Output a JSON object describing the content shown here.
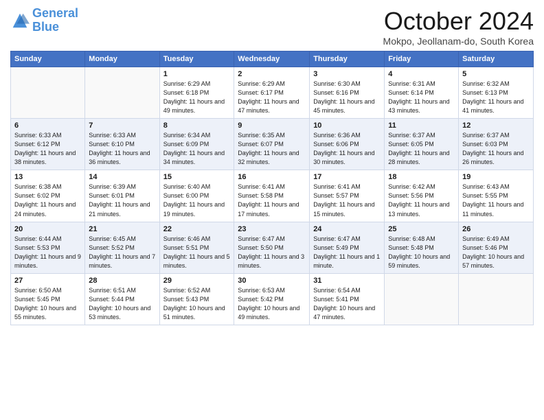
{
  "header": {
    "logo_general": "General",
    "logo_blue": "Blue",
    "title": "October 2024",
    "location": "Mokpo, Jeollanam-do, South Korea"
  },
  "weekdays": [
    "Sunday",
    "Monday",
    "Tuesday",
    "Wednesday",
    "Thursday",
    "Friday",
    "Saturday"
  ],
  "weeks": [
    [
      {
        "day": "",
        "detail": ""
      },
      {
        "day": "",
        "detail": ""
      },
      {
        "day": "1",
        "detail": "Sunrise: 6:29 AM\nSunset: 6:18 PM\nDaylight: 11 hours and 49 minutes."
      },
      {
        "day": "2",
        "detail": "Sunrise: 6:29 AM\nSunset: 6:17 PM\nDaylight: 11 hours and 47 minutes."
      },
      {
        "day": "3",
        "detail": "Sunrise: 6:30 AM\nSunset: 6:16 PM\nDaylight: 11 hours and 45 minutes."
      },
      {
        "day": "4",
        "detail": "Sunrise: 6:31 AM\nSunset: 6:14 PM\nDaylight: 11 hours and 43 minutes."
      },
      {
        "day": "5",
        "detail": "Sunrise: 6:32 AM\nSunset: 6:13 PM\nDaylight: 11 hours and 41 minutes."
      }
    ],
    [
      {
        "day": "6",
        "detail": "Sunrise: 6:33 AM\nSunset: 6:12 PM\nDaylight: 11 hours and 38 minutes."
      },
      {
        "day": "7",
        "detail": "Sunrise: 6:33 AM\nSunset: 6:10 PM\nDaylight: 11 hours and 36 minutes."
      },
      {
        "day": "8",
        "detail": "Sunrise: 6:34 AM\nSunset: 6:09 PM\nDaylight: 11 hours and 34 minutes."
      },
      {
        "day": "9",
        "detail": "Sunrise: 6:35 AM\nSunset: 6:07 PM\nDaylight: 11 hours and 32 minutes."
      },
      {
        "day": "10",
        "detail": "Sunrise: 6:36 AM\nSunset: 6:06 PM\nDaylight: 11 hours and 30 minutes."
      },
      {
        "day": "11",
        "detail": "Sunrise: 6:37 AM\nSunset: 6:05 PM\nDaylight: 11 hours and 28 minutes."
      },
      {
        "day": "12",
        "detail": "Sunrise: 6:37 AM\nSunset: 6:03 PM\nDaylight: 11 hours and 26 minutes."
      }
    ],
    [
      {
        "day": "13",
        "detail": "Sunrise: 6:38 AM\nSunset: 6:02 PM\nDaylight: 11 hours and 24 minutes."
      },
      {
        "day": "14",
        "detail": "Sunrise: 6:39 AM\nSunset: 6:01 PM\nDaylight: 11 hours and 21 minutes."
      },
      {
        "day": "15",
        "detail": "Sunrise: 6:40 AM\nSunset: 6:00 PM\nDaylight: 11 hours and 19 minutes."
      },
      {
        "day": "16",
        "detail": "Sunrise: 6:41 AM\nSunset: 5:58 PM\nDaylight: 11 hours and 17 minutes."
      },
      {
        "day": "17",
        "detail": "Sunrise: 6:41 AM\nSunset: 5:57 PM\nDaylight: 11 hours and 15 minutes."
      },
      {
        "day": "18",
        "detail": "Sunrise: 6:42 AM\nSunset: 5:56 PM\nDaylight: 11 hours and 13 minutes."
      },
      {
        "day": "19",
        "detail": "Sunrise: 6:43 AM\nSunset: 5:55 PM\nDaylight: 11 hours and 11 minutes."
      }
    ],
    [
      {
        "day": "20",
        "detail": "Sunrise: 6:44 AM\nSunset: 5:53 PM\nDaylight: 11 hours and 9 minutes."
      },
      {
        "day": "21",
        "detail": "Sunrise: 6:45 AM\nSunset: 5:52 PM\nDaylight: 11 hours and 7 minutes."
      },
      {
        "day": "22",
        "detail": "Sunrise: 6:46 AM\nSunset: 5:51 PM\nDaylight: 11 hours and 5 minutes."
      },
      {
        "day": "23",
        "detail": "Sunrise: 6:47 AM\nSunset: 5:50 PM\nDaylight: 11 hours and 3 minutes."
      },
      {
        "day": "24",
        "detail": "Sunrise: 6:47 AM\nSunset: 5:49 PM\nDaylight: 11 hours and 1 minute."
      },
      {
        "day": "25",
        "detail": "Sunrise: 6:48 AM\nSunset: 5:48 PM\nDaylight: 10 hours and 59 minutes."
      },
      {
        "day": "26",
        "detail": "Sunrise: 6:49 AM\nSunset: 5:46 PM\nDaylight: 10 hours and 57 minutes."
      }
    ],
    [
      {
        "day": "27",
        "detail": "Sunrise: 6:50 AM\nSunset: 5:45 PM\nDaylight: 10 hours and 55 minutes."
      },
      {
        "day": "28",
        "detail": "Sunrise: 6:51 AM\nSunset: 5:44 PM\nDaylight: 10 hours and 53 minutes."
      },
      {
        "day": "29",
        "detail": "Sunrise: 6:52 AM\nSunset: 5:43 PM\nDaylight: 10 hours and 51 minutes."
      },
      {
        "day": "30",
        "detail": "Sunrise: 6:53 AM\nSunset: 5:42 PM\nDaylight: 10 hours and 49 minutes."
      },
      {
        "day": "31",
        "detail": "Sunrise: 6:54 AM\nSunset: 5:41 PM\nDaylight: 10 hours and 47 minutes."
      },
      {
        "day": "",
        "detail": ""
      },
      {
        "day": "",
        "detail": ""
      }
    ]
  ]
}
